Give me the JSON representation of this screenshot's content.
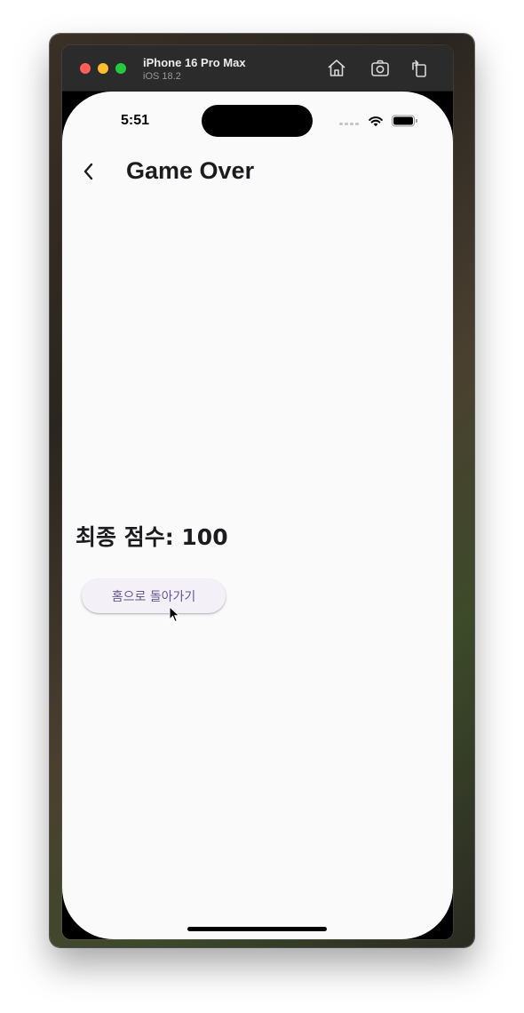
{
  "simulator": {
    "device_name": "iPhone 16 Pro Max",
    "os_version": "iOS 18.2",
    "toolbar_icons": [
      "home-icon",
      "screenshot-icon",
      "rotate-icon"
    ]
  },
  "status_bar": {
    "time": "5:51",
    "icons": [
      "cellular-icon",
      "wifi-icon",
      "battery-icon"
    ]
  },
  "navigation": {
    "back_icon": "chevron-left-icon",
    "title": "Game Over"
  },
  "main": {
    "score_text": "최종 점수: 100",
    "home_button_label": "홈으로 돌아가기"
  },
  "colors": {
    "screen_background": "#fafafa",
    "button_background": "#f4f0f8",
    "button_text": "#65558f",
    "title_text": "#1c1b1f"
  }
}
